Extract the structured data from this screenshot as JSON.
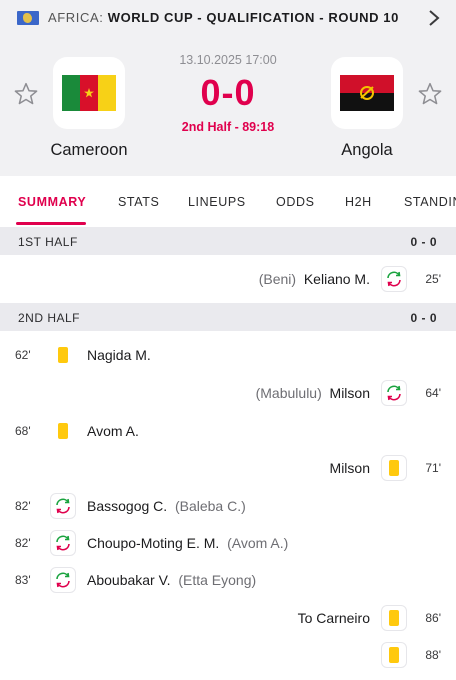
{
  "topbar": {
    "country": "AFRICA:",
    "competition": "WORLD CUP - QUALIFICATION - ROUND 10"
  },
  "match": {
    "datetime": "13.10.2025 17:00",
    "score": "0-0",
    "status": "2nd Half - 89:18",
    "home": {
      "name": "Cameroon"
    },
    "away": {
      "name": "Angola"
    }
  },
  "tabs": [
    "SUMMARY",
    "STATS",
    "LINEUPS",
    "ODDS",
    "H2H",
    "STANDINGS"
  ],
  "active_tab": "SUMMARY",
  "sections": [
    {
      "label": "1ST HALF",
      "score": "0 - 0"
    },
    {
      "label": "2ND HALF",
      "score": "0 - 0"
    }
  ],
  "events": [
    {
      "side": "away",
      "minute": "25'",
      "type": "substitution",
      "player": "Keliano M.",
      "detail": "(Beni)"
    },
    {
      "side": "home",
      "minute": "62'",
      "type": "yellow-card",
      "player": "Nagida M.",
      "detail": ""
    },
    {
      "side": "away",
      "minute": "64'",
      "type": "substitution",
      "player": "Milson",
      "detail": "(Mabululu)"
    },
    {
      "side": "home",
      "minute": "68'",
      "type": "yellow-card",
      "player": "Avom A.",
      "detail": ""
    },
    {
      "side": "away",
      "minute": "71'",
      "type": "yellow-card",
      "player": "Milson",
      "detail": ""
    },
    {
      "side": "home",
      "minute": "82'",
      "type": "substitution",
      "player": "Bassogog C.",
      "detail": "(Baleba C.)"
    },
    {
      "side": "home",
      "minute": "82'",
      "type": "substitution",
      "player": "Choupo-Moting E. M.",
      "detail": "(Avom A.)"
    },
    {
      "side": "home",
      "minute": "83'",
      "type": "substitution",
      "player": "Aboubakar V.",
      "detail": "(Etta Eyong)"
    },
    {
      "side": "away",
      "minute": "86'",
      "type": "yellow-card",
      "player": "To Carneiro",
      "detail": ""
    },
    {
      "side": "away",
      "minute": "88'",
      "type": "yellow-card",
      "player": "",
      "detail": ""
    }
  ],
  "colors": {
    "accent": "#e0004d",
    "yellow_card": "#ffc90e",
    "sub_in": "#1aa33f",
    "sub_out": "#e0004d",
    "header_bg": "#f1f1f3"
  },
  "icons": {
    "league_flag": "africa-flag-icon",
    "next": "chevron-right-icon",
    "favorite": "star-outline-icon",
    "yellow_card": "yellow-card-icon",
    "substitution": "substitution-icon"
  }
}
